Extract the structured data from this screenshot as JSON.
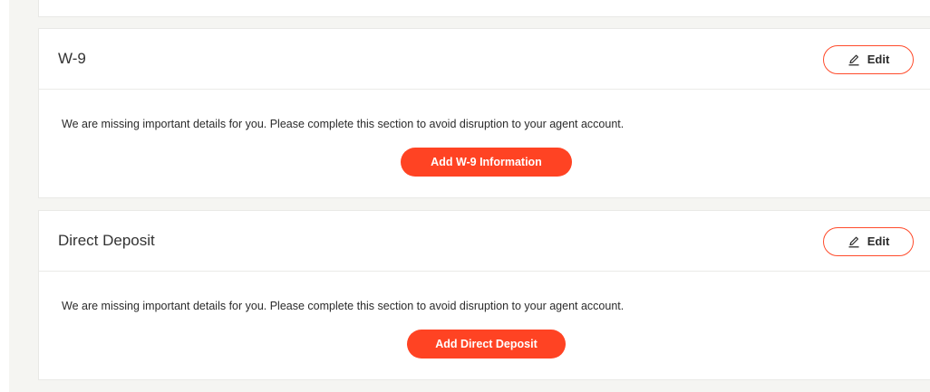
{
  "colors": {
    "accent": "#ff4323",
    "page_background": "#f5f5f2",
    "card_background": "#ffffff",
    "border": "#e9e9e6"
  },
  "icons": {
    "edit": "pencil-icon"
  },
  "sections": [
    {
      "title": "W-9",
      "edit_label": "Edit",
      "message": "We are missing important details for you. Please complete this section to avoid disruption to your agent account.",
      "cta_label": "Add W-9 Information"
    },
    {
      "title": "Direct Deposit",
      "edit_label": "Edit",
      "message": "We are missing important details for you. Please complete this section to avoid disruption to your agent account.",
      "cta_label": "Add Direct Deposit"
    }
  ]
}
